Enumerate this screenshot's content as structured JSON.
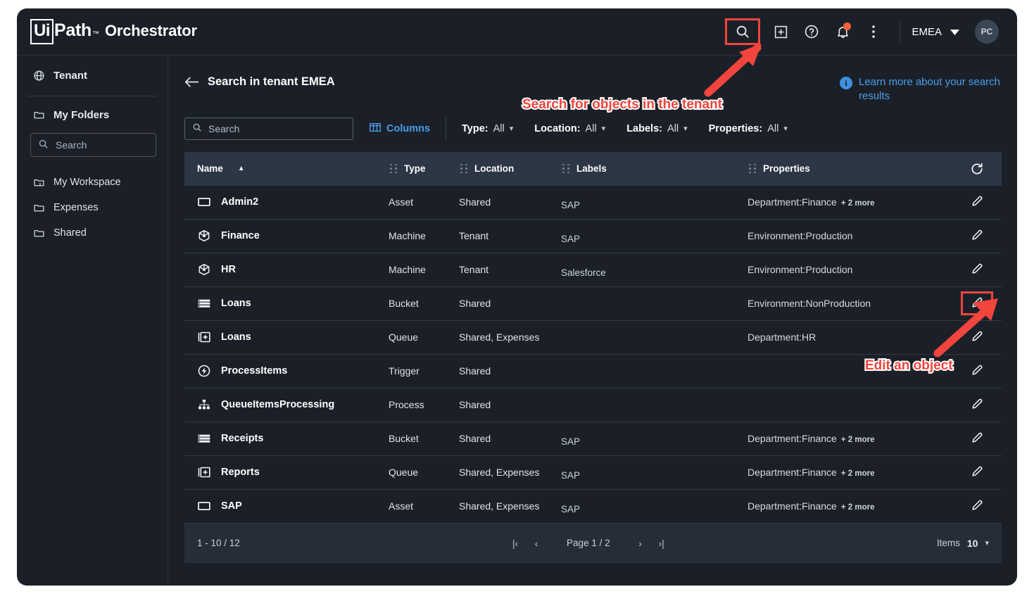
{
  "app": {
    "brand_ui": "Ui",
    "brand_path": "Path",
    "brand_tm": "™",
    "brand_product": "Orchestrator",
    "tenant_selector": "EMEA",
    "avatar_initials": "PC"
  },
  "header_icons": [
    {
      "name": "search-icon",
      "label": "Search"
    },
    {
      "name": "add-square-icon",
      "label": "Add"
    },
    {
      "name": "help-circle-icon",
      "label": "Help"
    },
    {
      "name": "notifications-bell-icon",
      "label": "Notifications"
    },
    {
      "name": "more-vertical-icon",
      "label": "More options"
    }
  ],
  "sidebar": {
    "tenant_label": "Tenant",
    "my_folders_label": "My Folders",
    "search_placeholder": "Search",
    "folders": [
      {
        "label": "My Workspace",
        "icon": "folder-star-icon"
      },
      {
        "label": "Expenses",
        "icon": "folder-icon"
      },
      {
        "label": "Shared",
        "icon": "folder-icon"
      }
    ]
  },
  "page": {
    "title": "Search in tenant EMEA",
    "back_label": "Back",
    "learn_more": "Learn more about your search results",
    "info_glyph": "i"
  },
  "filterbar": {
    "search_placeholder": "Search",
    "columns_label": "Columns",
    "filters": [
      {
        "label": "Type:",
        "value": "All"
      },
      {
        "label": "Location:",
        "value": "All"
      },
      {
        "label": "Labels:",
        "value": "All"
      },
      {
        "label": "Properties:",
        "value": "All"
      }
    ]
  },
  "table": {
    "columns": [
      {
        "key": "name",
        "label": "Name",
        "sorted": "asc"
      },
      {
        "key": "type",
        "label": "Type"
      },
      {
        "key": "location",
        "label": "Location"
      },
      {
        "key": "labels",
        "label": "Labels"
      },
      {
        "key": "properties",
        "label": "Properties"
      }
    ],
    "refresh_label": "Refresh",
    "rows": [
      {
        "icon": "asset-icon",
        "name": "Admin2",
        "type": "Asset",
        "location": "Shared",
        "labels": "SAP",
        "property": "Department:Finance",
        "more": "+ 2 more",
        "highlight_edit": false
      },
      {
        "icon": "machine-icon",
        "name": "Finance",
        "type": "Machine",
        "location": "Tenant",
        "labels": "SAP",
        "property": "Environment:Production",
        "more": "",
        "highlight_edit": false
      },
      {
        "icon": "machine-icon",
        "name": "HR",
        "type": "Machine",
        "location": "Tenant",
        "labels": "Salesforce",
        "property": "Environment:Production",
        "more": "",
        "highlight_edit": false
      },
      {
        "icon": "bucket-icon",
        "name": "Loans",
        "type": "Bucket",
        "location": "Shared",
        "labels": "",
        "property": "Environment:NonProduction",
        "more": "",
        "highlight_edit": true
      },
      {
        "icon": "queue-icon",
        "name": "Loans",
        "type": "Queue",
        "location": "Shared, Expenses",
        "labels": "",
        "property": "Department:HR",
        "more": "",
        "highlight_edit": false
      },
      {
        "icon": "trigger-icon",
        "name": "ProcessItems",
        "type": "Trigger",
        "location": "Shared",
        "labels": "",
        "property": "",
        "more": "",
        "highlight_edit": false
      },
      {
        "icon": "process-icon",
        "name": "QueueItemsProcessing",
        "type": "Process",
        "location": "Shared",
        "labels": "",
        "property": "",
        "more": "",
        "highlight_edit": false
      },
      {
        "icon": "bucket-icon",
        "name": "Receipts",
        "type": "Bucket",
        "location": "Shared",
        "labels": "SAP",
        "property": "Department:Finance",
        "more": "+ 2 more",
        "highlight_edit": false
      },
      {
        "icon": "queue-icon",
        "name": "Reports",
        "type": "Queue",
        "location": "Shared, Expenses",
        "labels": "SAP",
        "property": "Department:Finance",
        "more": "+ 2 more",
        "highlight_edit": false
      },
      {
        "icon": "asset-icon",
        "name": "SAP",
        "type": "Asset",
        "location": "Shared, Expenses",
        "labels": "SAP",
        "property": "Department:Finance",
        "more": "+ 2 more",
        "highlight_edit": false
      }
    ]
  },
  "footer": {
    "range": "1 - 10 / 12",
    "first_glyph": "|‹",
    "prev_glyph": "‹",
    "page_label": "Page 1 / 2",
    "next_glyph": "›",
    "last_glyph": "›|",
    "items_label": "Items",
    "items_value": "10"
  },
  "annotations": [
    {
      "text": "Search for objects in the tenant",
      "name": "annotation-search-tenant"
    },
    {
      "text": "Edit an object",
      "name": "annotation-edit-object"
    }
  ],
  "colors": {
    "accent_blue": "#4a9eec",
    "annotation_red": "#f2453d",
    "badge_orange": "#f4623a",
    "window_bg": "#1b2028",
    "header_row_bg": "#2c3644"
  }
}
